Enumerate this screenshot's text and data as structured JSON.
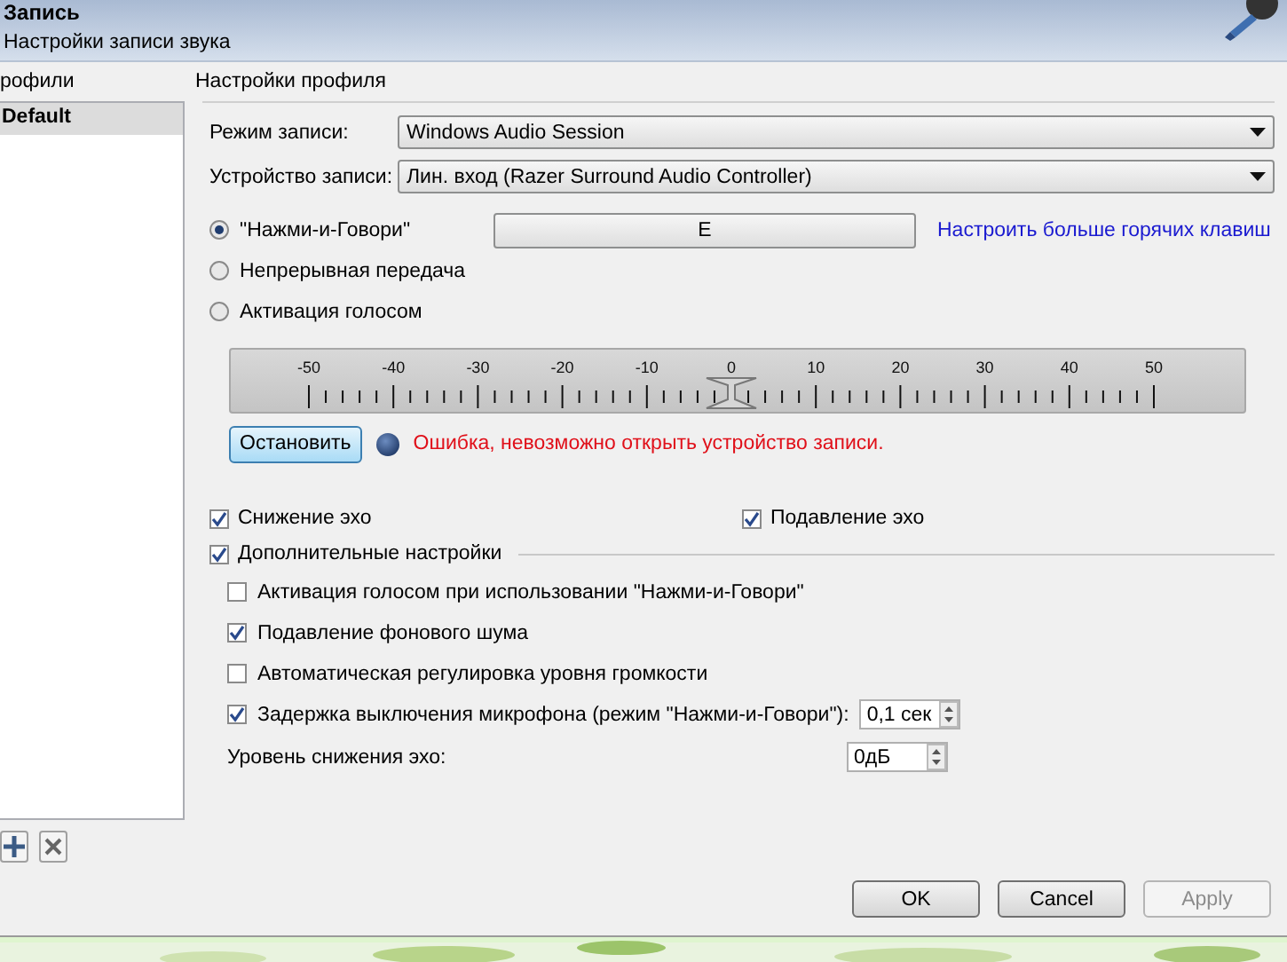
{
  "header": {
    "title": "Запись",
    "subtitle": "Настройки записи звука"
  },
  "profiles": {
    "title": "рофили",
    "items": [
      {
        "label": "Default",
        "selected": true
      }
    ]
  },
  "settings": {
    "title": "Настройки профиля",
    "combos": [
      {
        "label": "Режим записи:",
        "value": "Windows Audio Session"
      },
      {
        "label": "Устройство записи:",
        "value": "Лин. вход (Razer Surround Audio Controller)"
      }
    ],
    "modes": [
      {
        "label": "\"Нажми-и-Говори\"",
        "selected": true
      },
      {
        "label": "Непрерывная передача",
        "selected": false
      },
      {
        "label": "Активация голосом",
        "selected": false
      }
    ],
    "hotkey": "E",
    "hotkey_link": "Настроить больше горячих клавиш",
    "meter": {
      "scale_labels": [
        "-50",
        "-40",
        "-30",
        "-20",
        "-10",
        "0",
        "10",
        "20",
        "30",
        "40",
        "50"
      ],
      "level": 0.5
    },
    "stop_button": "Остановить",
    "status": "Ошибка, невозможно открыть устройство записи.",
    "echo": [
      {
        "label": "Снижение эхо",
        "checked": true
      },
      {
        "label": "Подавление эхо",
        "checked": true
      }
    ],
    "advanced": {
      "label": "Дополнительные настройки",
      "checked": true,
      "options": [
        {
          "label": "Активация голосом при использовании \"Нажми-и-Говори\"",
          "checked": false
        },
        {
          "label": "Подавление фонового шума",
          "checked": true
        },
        {
          "label": "Автоматическая регулировка уровня громкости",
          "checked": false
        },
        {
          "label": "Задержка выключения микрофона (режим \"Нажми-и-Говори\"):",
          "checked": true,
          "spin": "0,1 сек"
        }
      ],
      "echo_level": {
        "label": "Уровень снижения эхо:",
        "value": "0дБ"
      }
    }
  },
  "buttons": [
    {
      "label": "OK",
      "disabled": false
    },
    {
      "label": "Cancel",
      "disabled": false
    },
    {
      "label": "Apply",
      "disabled": true
    }
  ]
}
